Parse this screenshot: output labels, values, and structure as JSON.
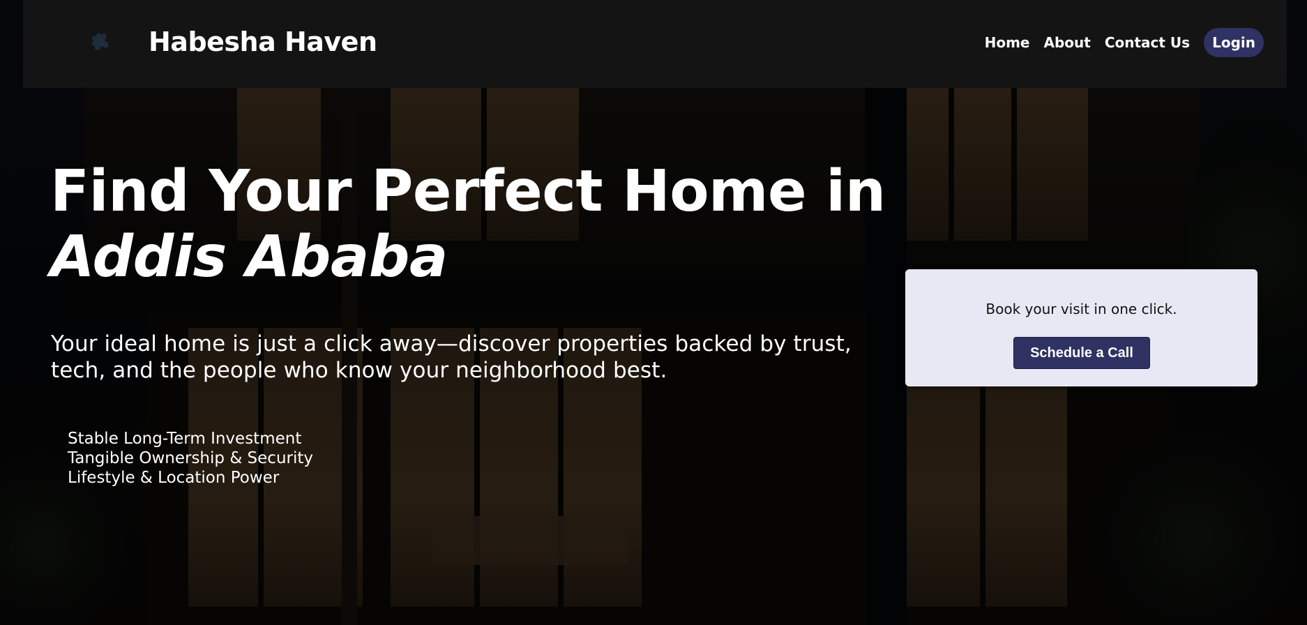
{
  "navbar": {
    "brand": "Habesha Haven",
    "logo_icon": "puzzle-icon",
    "links": [
      "Home",
      "About",
      "Contact Us"
    ],
    "login_label": "Login"
  },
  "hero": {
    "headline_line1": "Find Your Perfect Home in",
    "headline_line2": "Addis Ababa",
    "subtext": "Your ideal home is just a click away—discover properties backed by trust, tech, and the people who know your neighborhood best.",
    "benefits": [
      "Stable Long-Term Investment",
      "Tangible Ownership & Security",
      "Lifestyle & Location Power"
    ]
  },
  "booking_card": {
    "text": "Book your visit in one click.",
    "button_label": "Schedule a Call"
  },
  "colors": {
    "navbar_bg": "#161616",
    "accent": "#2f3263",
    "card_bg": "#e8e8f4",
    "text_light": "#ffffff"
  }
}
